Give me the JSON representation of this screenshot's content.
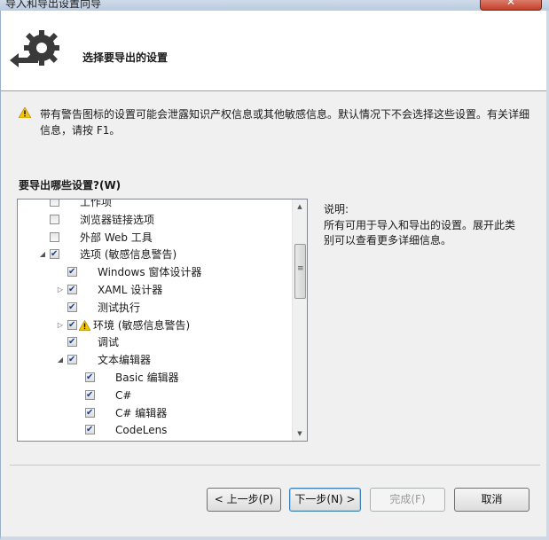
{
  "window": {
    "title": "导入和导出设置向导"
  },
  "header": {
    "title": "选择要导出的设置"
  },
  "warning": {
    "text": "带有警告图标的设置可能会泄露知识产权信息或其他敏感信息。默认情况下不会选择这些设置。有关详细信息，请按 F1。"
  },
  "question": {
    "label": "要导出哪些设置?(W)"
  },
  "tree": {
    "items": [
      {
        "label": "工作项",
        "checked": false
      },
      {
        "label": "浏览器链接选项",
        "checked": false
      },
      {
        "label": "外部 Web 工具",
        "checked": false
      },
      {
        "label": "选项 (敏感信息警告)",
        "checked": true,
        "expander": "expanded"
      },
      {
        "label": "Windows 窗体设计器",
        "checked": true
      },
      {
        "label": "XAML 设计器",
        "checked": true,
        "expander": "collapsed"
      },
      {
        "label": "测试执行",
        "checked": true
      },
      {
        "label": "环境 (敏感信息警告)",
        "checked": true,
        "expander": "collapsed",
        "warning": true
      },
      {
        "label": "调试",
        "checked": true
      },
      {
        "label": "文本编辑器",
        "checked": true,
        "expander": "expanded"
      },
      {
        "label": "Basic 编辑器",
        "checked": true
      },
      {
        "label": "C#",
        "checked": true
      },
      {
        "label": "C# 编辑器",
        "checked": true
      },
      {
        "label": "CodeLens",
        "checked": true
      }
    ]
  },
  "description": {
    "label": "说明:",
    "text": "所有可用于导入和导出的设置。展开此类别可以查看更多详细信息。"
  },
  "buttons": {
    "back": "< 上一步(P)",
    "next": "下一步(N) >",
    "finish": "完成(F)",
    "cancel": "取消"
  },
  "colors": {
    "warning": "#f5c400",
    "focus_border": "#3c7fb1",
    "check": "#1b3f90"
  }
}
